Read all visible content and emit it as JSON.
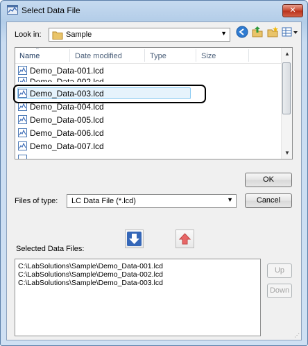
{
  "window": {
    "title": "Select Data File",
    "close_label": "✕"
  },
  "toolbar": {
    "look_in_label": "Look in:",
    "look_in_value": "Sample",
    "icons": [
      "back-icon",
      "up-folder-icon",
      "new-folder-icon",
      "view-menu-icon"
    ]
  },
  "file_list": {
    "columns": [
      "Name",
      "Date modified",
      "Type",
      "Size"
    ],
    "files": [
      {
        "name": "Demo_Data-001.lcd",
        "selected": false
      },
      {
        "name": "Demo_Data-002.lcd",
        "selected": false
      },
      {
        "name": "Demo_Data-003.lcd",
        "selected": true
      },
      {
        "name": "Demo_Data-004.lcd",
        "selected": false
      },
      {
        "name": "Demo_Data-005.lcd",
        "selected": false
      },
      {
        "name": "Demo_Data-006.lcd",
        "selected": false
      },
      {
        "name": "Demo_Data-007.lcd",
        "selected": false
      }
    ]
  },
  "files_of_type": {
    "label": "Files of type:",
    "value": "LC Data File (*.lcd)"
  },
  "buttons": {
    "ok": "OK",
    "cancel": "Cancel",
    "up": "Up",
    "down": "Down"
  },
  "selected_files": {
    "label": "Selected Data Files:",
    "items": [
      "C:\\LabSolutions\\Sample\\Demo_Data-001.lcd",
      "C:\\LabSolutions\\Sample\\Demo_Data-002.lcd",
      "C:\\LabSolutions\\Sample\\Demo_Data-003.lcd"
    ]
  },
  "colors": {
    "add_arrow": "#2f64b4",
    "remove_arrow": "#e25a5a",
    "selection_border": "#8ccbf2"
  }
}
